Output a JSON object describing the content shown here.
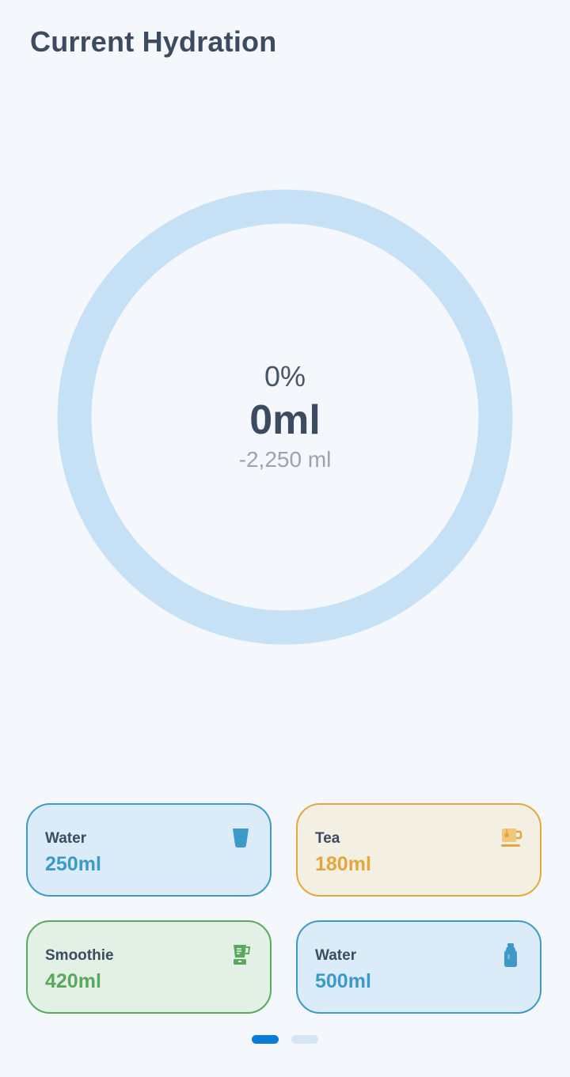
{
  "header": {
    "title": "Current Hydration"
  },
  "progress": {
    "percent_label": "0%",
    "amount_label": "0ml",
    "remaining_label": "-2,250 ml",
    "fraction": 0
  },
  "colors": {
    "ring_track": "#c6e0f6",
    "ring_fill": "#0a7bd6",
    "water": "#3d99c8",
    "tea": "#e3a73f",
    "smoothie": "#58a95c",
    "dot_active": "#0a7bd6",
    "dot_inactive": "#d5e5f3"
  },
  "drinks": [
    {
      "label": "Water",
      "volume": "250ml",
      "icon": "glass-icon"
    },
    {
      "label": "Tea",
      "volume": "180ml",
      "icon": "tea-mug-icon"
    },
    {
      "label": "Smoothie",
      "volume": "420ml",
      "icon": "blender-icon"
    },
    {
      "label": "Water",
      "volume": "500ml",
      "icon": "bottle-icon"
    }
  ],
  "pager": {
    "pages": 2,
    "active": 0
  }
}
